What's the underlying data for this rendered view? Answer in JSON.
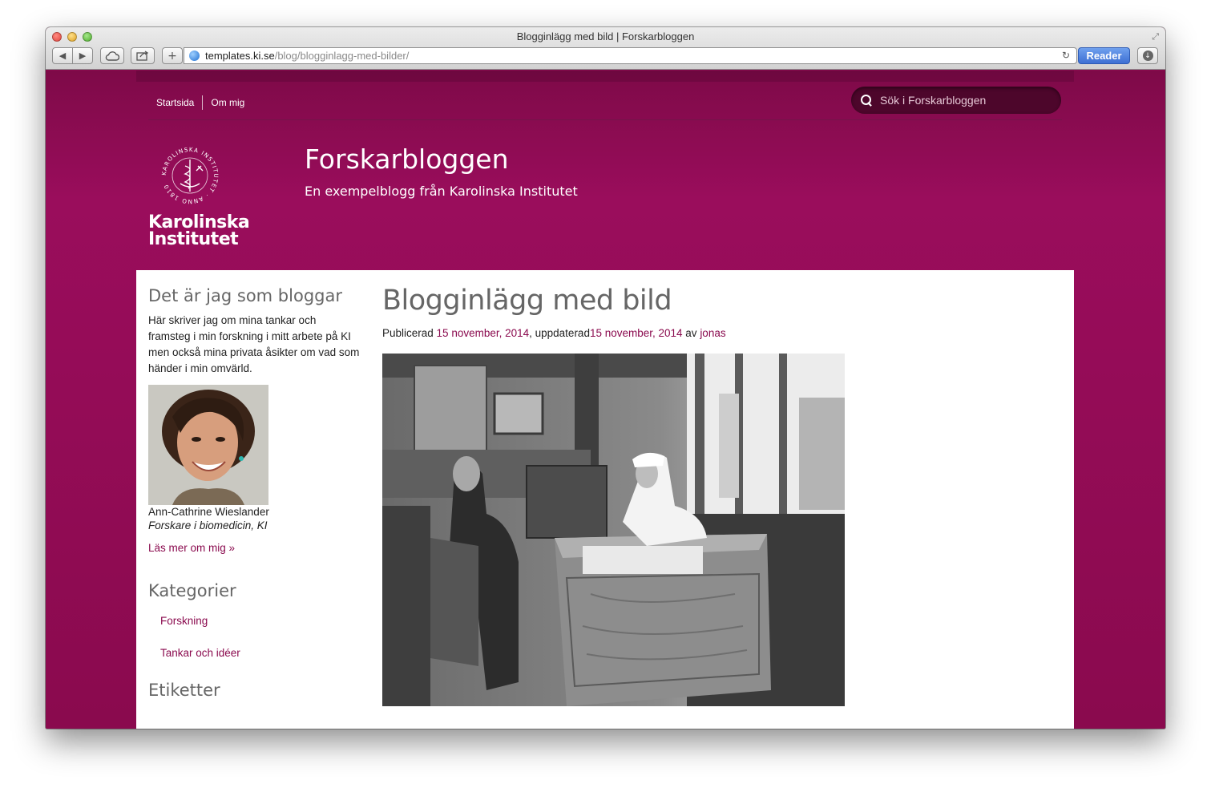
{
  "browser": {
    "window_title": "Blogginlägg med bild | Forskarbloggen",
    "url_host": "templates.ki.se",
    "url_path": "/blog/blogginlagg-med-bilder/",
    "reader_label": "Reader",
    "back_icon": "◀",
    "forward_icon": "▶",
    "plus_icon": "+",
    "reload_icon": "↻"
  },
  "header": {
    "nav": [
      {
        "label": "Startsida"
      },
      {
        "label": "Om mig"
      }
    ],
    "search_placeholder": "Sök i Forskarbloggen",
    "site_title": "Forskarbloggen",
    "site_subtitle": "En exempelblogg från Karolinska Institutet",
    "logo_line1": "Karolinska",
    "logo_line2": "Institutet",
    "logo_seal_text": "KAROLINSKA INSTITUTET · ANNO 1810"
  },
  "sidebar": {
    "about_heading": "Det är jag som bloggar",
    "about_text": "Här skriver jag om mina tankar och framsteg i min forskning i mitt arbete på KI men också mina privata åsikter om vad som händer i min omvärld.",
    "author_name": "Ann-Cathrine Wieslander",
    "author_role": "Forskare i biomedicin, KI",
    "read_more": "Läs mer om mig »",
    "categories_heading": "Kategorier",
    "categories": [
      {
        "label": "Forskning"
      },
      {
        "label": "Tankar och idéer"
      }
    ],
    "tags_heading": "Etiketter"
  },
  "post": {
    "title": "Blogginlägg med bild",
    "published_prefix": "Publicerad ",
    "published_date": "15 november, 2014",
    "updated_prefix": ", uppdaterad",
    "updated_date": "15 november, 2014",
    "author_prefix": " av ",
    "author": "jonas"
  },
  "colors": {
    "brand": "#8a0a4e",
    "link": "#8a0a4e",
    "heading": "#666666"
  }
}
